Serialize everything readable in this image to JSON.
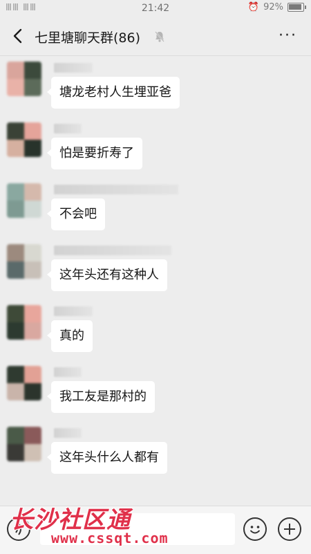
{
  "status_bar": {
    "carrier_signal": "ⅢⅢ ⅢⅢ",
    "time": "21:42",
    "battery": "92%"
  },
  "header": {
    "title": "七里塘聊天群(86)",
    "more_label": "···"
  },
  "messages": [
    {
      "text": "塘龙老村人生埋亚爸",
      "avatar_colors": [
        "#d9a59c",
        "#3c4a3c",
        "#e9b2a8",
        "#5c6b5a"
      ]
    },
    {
      "text": "怕是要折寿了",
      "avatar_colors": [
        "#3a4236",
        "#e5a49a",
        "#d6b0a0",
        "#28332b"
      ]
    },
    {
      "text": "不会吧",
      "avatar_colors": [
        "#8aa8a0",
        "#d5b9ac",
        "#7e9a92",
        "#cfd8d4"
      ]
    },
    {
      "text": "这年头还有这种人",
      "avatar_colors": [
        "#9c8a7e",
        "#d8d8d0",
        "#5a6a6a",
        "#c8c0b8"
      ]
    },
    {
      "text": "真的",
      "avatar_colors": [
        "#3e4a38",
        "#e8a69c",
        "#2c3a30",
        "#d9a8a0"
      ]
    },
    {
      "text": "我工友是那村的",
      "avatar_colors": [
        "#2f3a30",
        "#e2a195",
        "#c9b4aa",
        "#2b342c"
      ]
    },
    {
      "text": "这年头什么人都有",
      "avatar_colors": [
        "#4a5a48",
        "#8a5a5a",
        "#3a3a36",
        "#cfc0b4"
      ]
    }
  ],
  "watermark": {
    "title": "长沙社区通",
    "url": "www.cssqt.com"
  },
  "colors": {
    "background": "#ededed",
    "bubble": "#ffffff",
    "watermark": "#e0304a"
  },
  "icons": {
    "back": "chevron-left-icon",
    "mute": "bell-off-icon",
    "voice": "voice-icon",
    "emoji": "emoji-icon",
    "plus": "plus-icon"
  }
}
